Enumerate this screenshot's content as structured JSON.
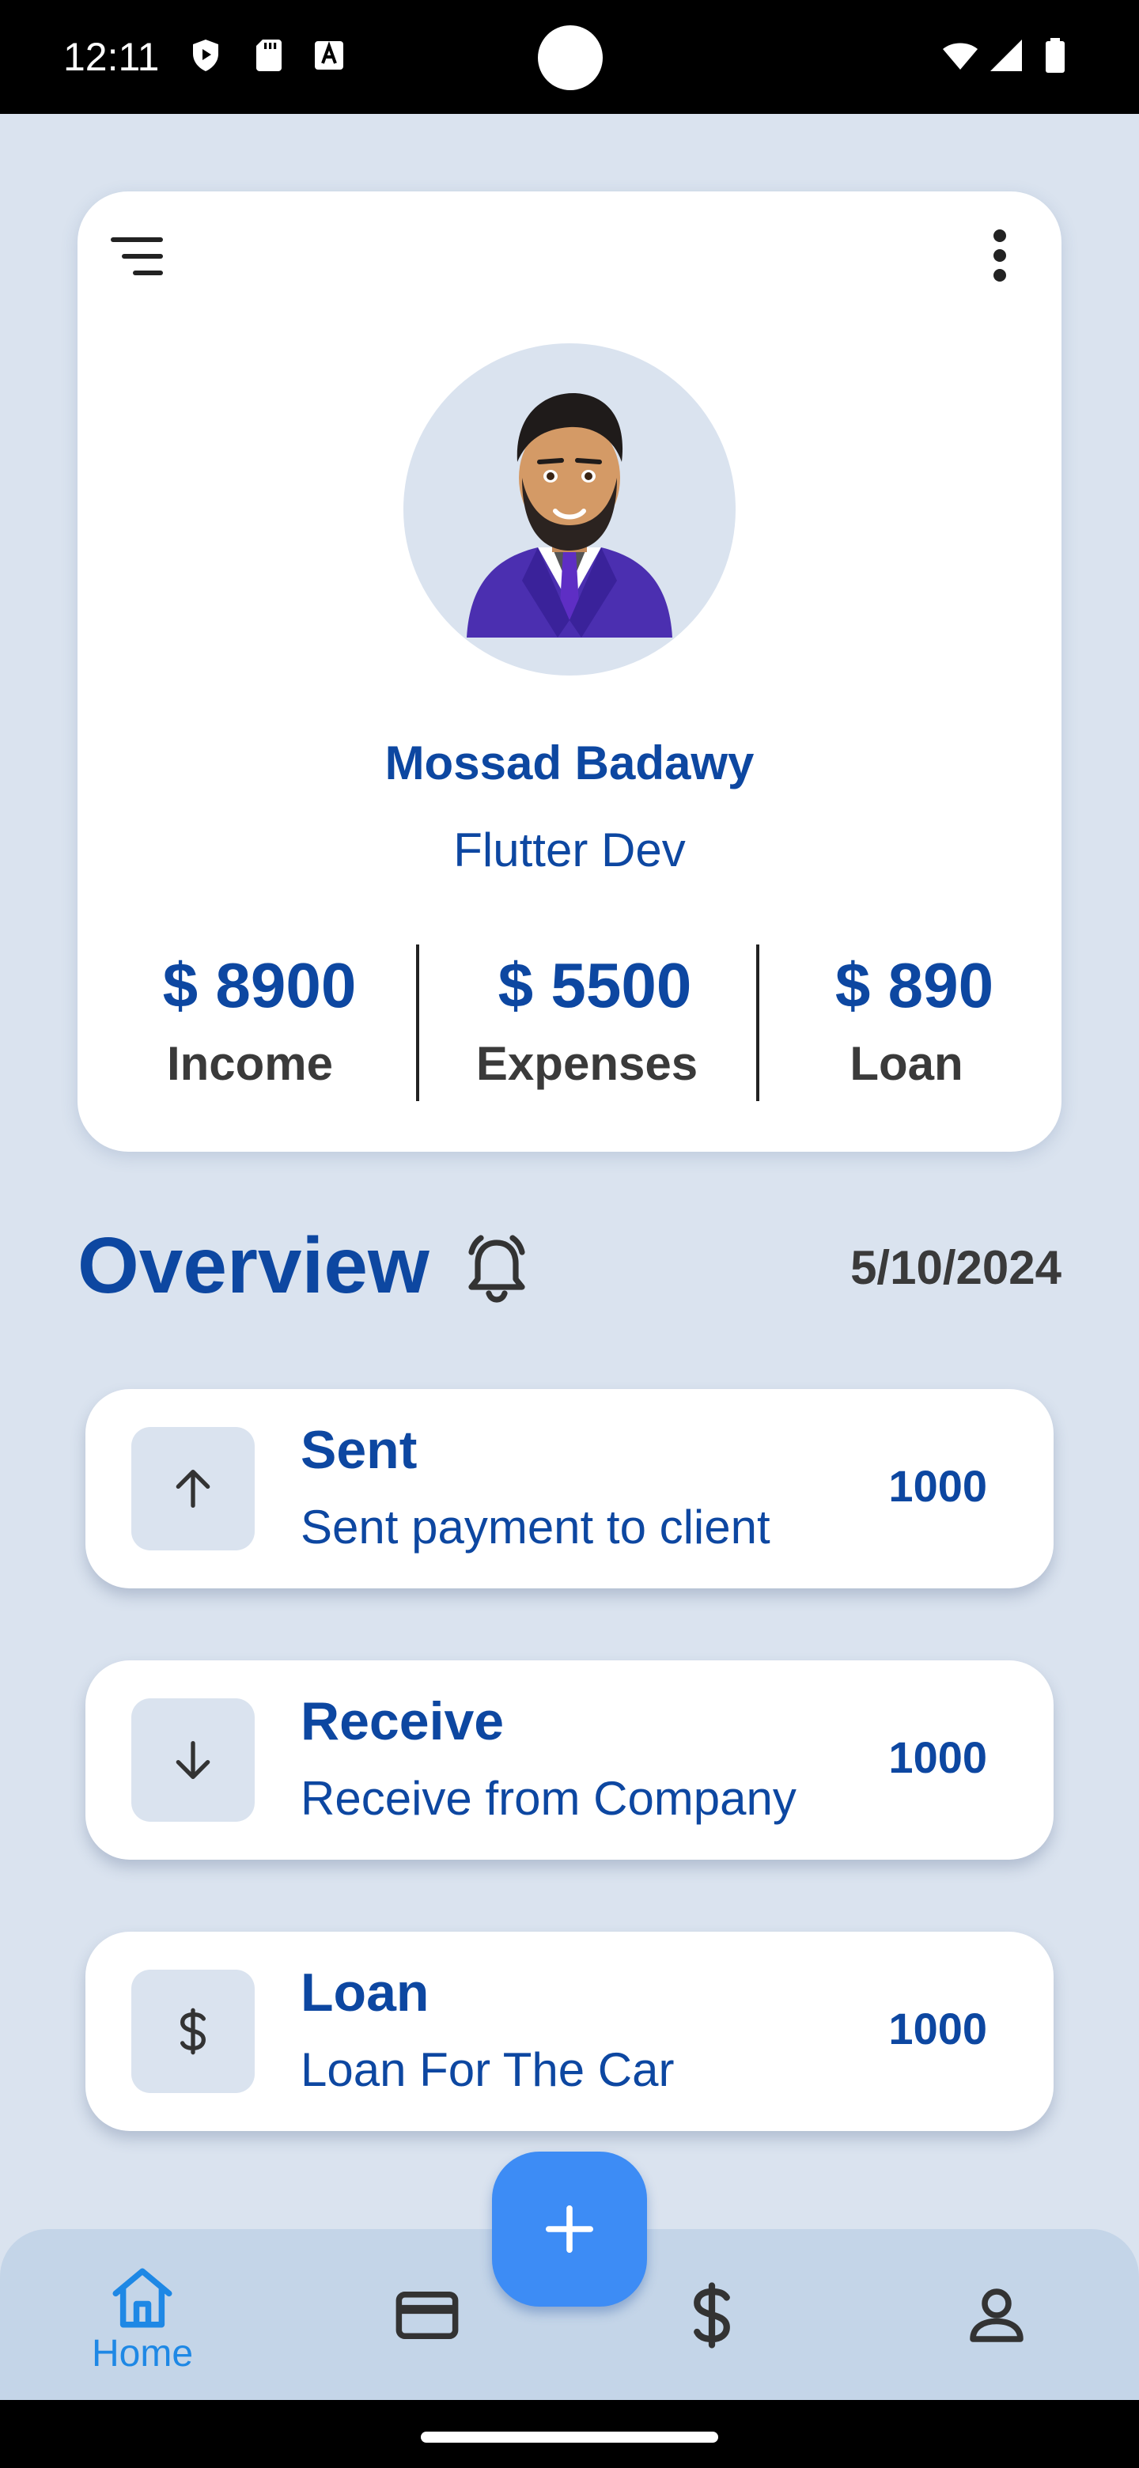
{
  "status_bar": {
    "time": "12:11",
    "icons": [
      "shield-play-icon",
      "sd-card-icon",
      "keyboard-a-icon",
      "wifi-icon",
      "signal-icon",
      "battery-icon"
    ]
  },
  "profile": {
    "name": "Mossad Badawy",
    "role": "Flutter Dev",
    "stats": [
      {
        "value": "$ 8900",
        "label": "Income"
      },
      {
        "value": "$ 5500",
        "label": "Expenses"
      },
      {
        "value": "$ 890",
        "label": "Loan"
      }
    ]
  },
  "overview": {
    "title": "Overview",
    "date": "5/10/2024"
  },
  "transactions": [
    {
      "icon": "arrow-up-icon",
      "title": "Sent",
      "description": "Sent payment to client",
      "amount": "1000"
    },
    {
      "icon": "arrow-down-icon",
      "title": "Receive",
      "description": "Receive from Company",
      "amount": "1000"
    },
    {
      "icon": "dollar-icon",
      "title": "Loan",
      "description": "Loan For The Car",
      "amount": "1000"
    }
  ],
  "bottom_nav": {
    "items": [
      {
        "icon": "home-icon",
        "label": "Home",
        "active": true
      },
      {
        "icon": "card-icon",
        "label": ""
      },
      {
        "icon": "dollar-icon",
        "label": ""
      },
      {
        "icon": "person-icon",
        "label": ""
      }
    ],
    "fab_icon": "plus-icon"
  },
  "colors": {
    "background": "#dae3ef",
    "primary": "#0d47a1",
    "accent": "#3d8cf5",
    "nav_bg": "#c4d5e8"
  }
}
